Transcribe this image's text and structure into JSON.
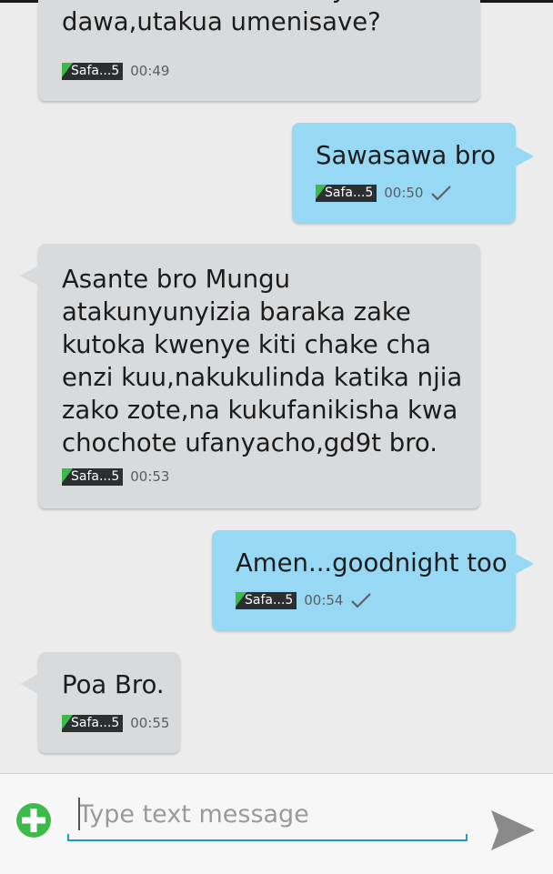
{
  "messages": [
    {
      "direction": "in",
      "text": "na tishio na biashara ya meno na\ndawa,utakua umenisave?",
      "sim": "Safa...5",
      "time": "00:49",
      "check": false
    },
    {
      "direction": "out",
      "text": "Sawasawa bro",
      "sim": "Safa...5",
      "time": "00:50",
      "check": true
    },
    {
      "direction": "in",
      "text": "Asante bro Mungu\natakunyunyizia baraka zake\nkutoka kwenye kiti chake cha\nenzi kuu,nakukulinda katika njia\nzako zote,na kukufanikisha kwa\nchochote ufanyacho,gd9t bro.",
      "sim": "Safa...5",
      "time": "00:53",
      "check": false
    },
    {
      "direction": "out",
      "text": "Amen...goodnight too",
      "sim": "Safa...5",
      "time": "00:54",
      "check": true
    },
    {
      "direction": "in",
      "text": "Poa Bro.",
      "sim": "Safa...5",
      "time": "00:55",
      "check": false
    }
  ],
  "composer": {
    "placeholder": "Type text message",
    "add_icon": "add-circle-icon",
    "send_icon": "send-arrow-icon"
  },
  "colors": {
    "incoming_bubble": "#d8dadc",
    "outgoing_bubble": "#97d9f5",
    "accent": "#1a9ad6",
    "add_button": "#3dbb4a"
  }
}
